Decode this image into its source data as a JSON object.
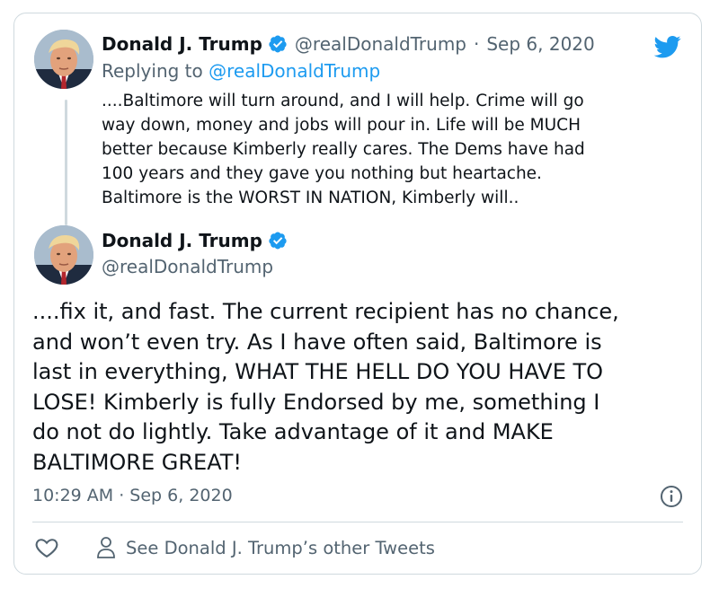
{
  "reply_tweet": {
    "author_name": "Donald J. Trump",
    "handle": "@realDonaldTrump",
    "separator": "·",
    "date": "Sep 6, 2020",
    "replying_label": "Replying to",
    "replying_handle": "@realDonaldTrump",
    "text": "....Baltimore will turn around, and I will help. Crime will go\nway down, money and jobs will pour in. Life will be MUCH\nbetter because Kimberly really cares. The Dems have had\n100 years and they gave you nothing but heartache.\nBaltimore is the WORST IN NATION, Kimberly will.."
  },
  "main_tweet": {
    "author_name": "Donald J. Trump",
    "handle": "@realDonaldTrump",
    "text": "....fix it, and fast. The current recipient has no chance,\nand won’t even try. As I have often said, Baltimore is\nlast in everything, WHAT THE HELL DO YOU HAVE TO\nLOSE! Kimberly is fully Endorsed by me, something I\ndo not do lightly. Take advantage of it and MAKE\nBALTIMORE GREAT!",
    "timestamp": "10:29 AM · Sep 6, 2020"
  },
  "footer": {
    "other_tweets_label": "See Donald J. Trump’s other Tweets"
  },
  "icons": {
    "logo": "twitter-bird-icon",
    "verified": "verified-badge-icon",
    "like": "heart-icon",
    "profile": "person-icon",
    "info": "info-icon"
  },
  "colors": {
    "accent": "#1d9bf0",
    "text": "#0f1419",
    "secondary": "#536471",
    "border": "#cfd9de"
  }
}
